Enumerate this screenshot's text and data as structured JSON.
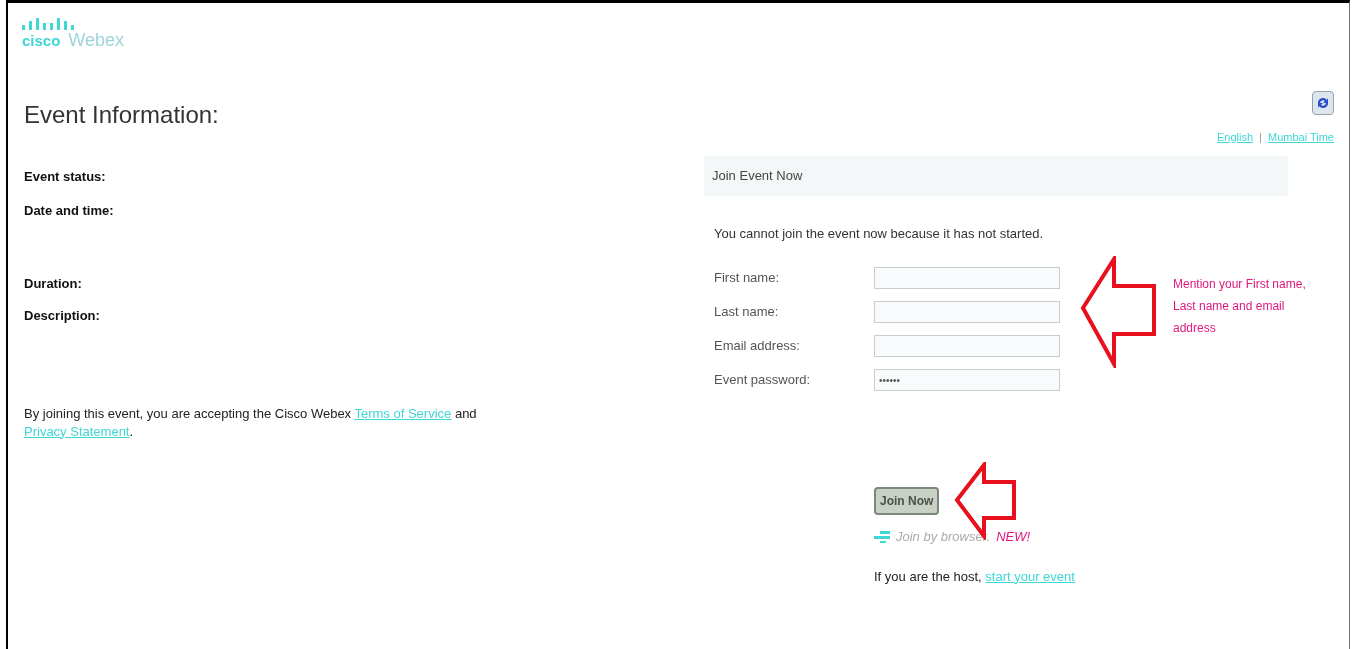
{
  "header": {
    "brand": "cisco",
    "product": "Webex"
  },
  "title": "Event Information:",
  "links": [
    {
      "label": "English"
    },
    {
      "label": "Mumbai Time"
    }
  ],
  "link_separator": "|",
  "details": [
    {
      "label": "Event status:"
    },
    {
      "label": "Date and time:"
    },
    {
      "label": "Duration:"
    },
    {
      "label": "Description:"
    }
  ],
  "terms": {
    "text": "By joining this event, you are accepting the Cisco Webex",
    "terms_link": "Terms of Service",
    "joiner": "and",
    "privacy_link": "Privacy Statement",
    "end": "."
  },
  "join_panel": {
    "title": "Join Event Now",
    "message": "You cannot join the event now because it has not started.",
    "fields": [
      {
        "label": "First name:"
      },
      {
        "label": "Last name:"
      },
      {
        "label": "Email address:"
      },
      {
        "label": "Event password:",
        "value": "••••••"
      }
    ],
    "annotation": "Mention your First name, Last name and email address",
    "join_button": {
      "label": "Join Now",
      "disabled": true
    },
    "browser_join": {
      "label": "Join by browser.",
      "badge": "NEW!"
    },
    "host_note": {
      "text": "If you are the host,",
      "link": "start your event"
    }
  }
}
